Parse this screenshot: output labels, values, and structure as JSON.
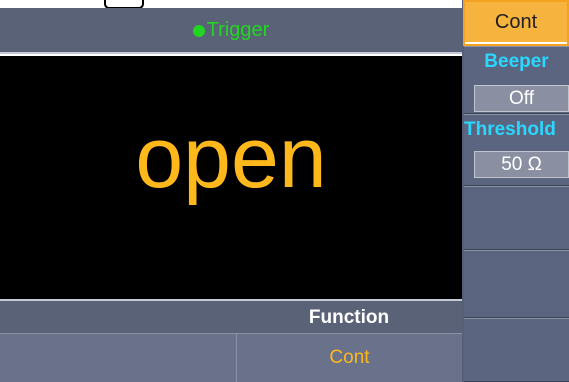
{
  "colors": {
    "panel": "#5a6277",
    "display_bg": "#000000",
    "accent_orange": "#f6b43f",
    "reading": "#ffb81c",
    "trigger_green": "#21d621",
    "label_cyan": "#2ad7ff",
    "function_text": "#ffffff"
  },
  "status": {
    "indicator": "green-dot",
    "label": "Trigger"
  },
  "display": {
    "reading": "open"
  },
  "function_bar": {
    "label": "Function"
  },
  "function_row": [
    "",
    "Cont"
  ],
  "softkeys": {
    "title": "Cont",
    "beeper": {
      "label": "Beeper",
      "value": "Off"
    },
    "threshold": {
      "label": "Threshold",
      "value": "50 Ω"
    },
    "empty": [
      "",
      "",
      ""
    ]
  }
}
